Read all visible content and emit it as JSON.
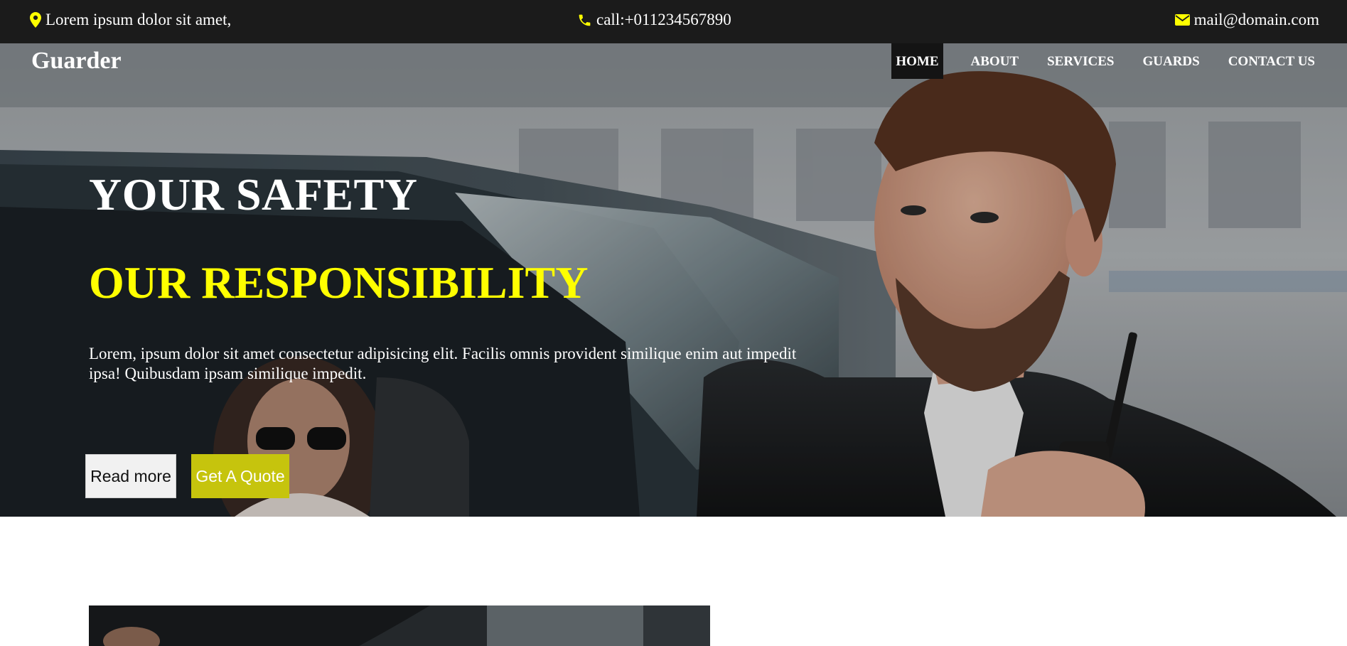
{
  "topbar": {
    "address": "Lorem ipsum dolor sit amet,",
    "phone": "call:+011234567890",
    "email": "mail@domain.com",
    "icons": [
      "map-marker-icon",
      "phone-icon",
      "envelope-icon"
    ],
    "icon_color": "#ffff00",
    "background": "#1b1b1b"
  },
  "header": {
    "brand": "Guarder",
    "nav": [
      {
        "label": "HOME",
        "active": true
      },
      {
        "label": "ABOUT",
        "active": false
      },
      {
        "label": "SERVICES",
        "active": false
      },
      {
        "label": "GUARDS",
        "active": false
      },
      {
        "label": "CONTACT US",
        "active": false
      }
    ]
  },
  "hero": {
    "headline_1": "YOUR SAFETY",
    "headline_2": "OUR RESPONSIBILITY",
    "headline_2_color": "#ffff00",
    "description": "Lorem, ipsum dolor sit amet consectetur adipisicing elit. Facilis omnis provident similique enim aut impedit ipsa! Quibusdam ipsam similique impedit.",
    "read_more_label": "Read more",
    "quote_label": "Get A Quote",
    "quote_color": "#c6c40d",
    "image": "security-guard-with-radio-photo"
  }
}
